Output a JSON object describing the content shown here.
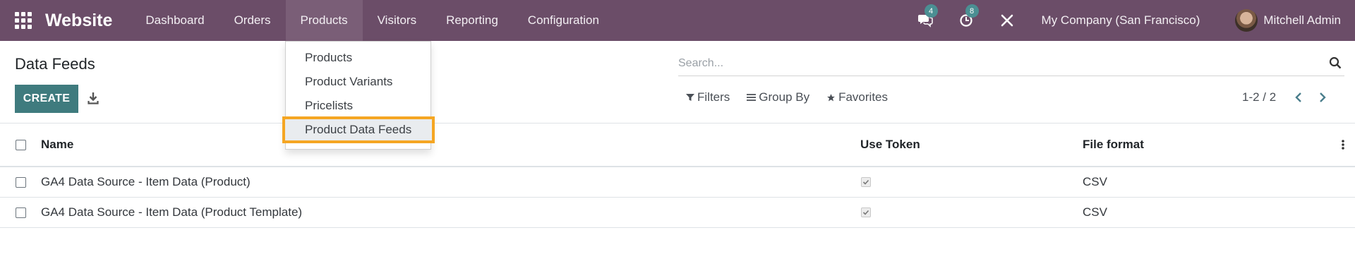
{
  "navbar": {
    "brand": "Website",
    "menu": [
      {
        "label": "Dashboard"
      },
      {
        "label": "Orders"
      },
      {
        "label": "Products"
      },
      {
        "label": "Visitors"
      },
      {
        "label": "Reporting"
      },
      {
        "label": "Configuration"
      }
    ],
    "messages_count": "4",
    "activities_count": "8",
    "company": "My Company (San Francisco)",
    "user": "Mitchell Admin"
  },
  "dropdown": {
    "items": [
      {
        "label": "Products"
      },
      {
        "label": "Product Variants"
      },
      {
        "label": "Pricelists"
      },
      {
        "label": "Product Data Feeds"
      }
    ]
  },
  "control_panel": {
    "title": "Data Feeds",
    "create_label": "CREATE",
    "search_placeholder": "Search...",
    "filters_label": "Filters",
    "groupby_label": "Group By",
    "favorites_label": "Favorites",
    "pager": "1-2 / 2"
  },
  "table": {
    "headers": {
      "name": "Name",
      "use_token": "Use Token",
      "file_format": "File format"
    },
    "rows": [
      {
        "name": "GA4 Data Source - Item Data (Product)",
        "use_token": true,
        "file_format": "CSV"
      },
      {
        "name": "GA4 Data Source - Item Data (Product Template)",
        "use_token": true,
        "file_format": "CSV"
      }
    ]
  },
  "colors": {
    "navbar": "#6b4d68",
    "primary": "#3f7b7e",
    "badge": "#4b8f93",
    "highlight": "#f5a623"
  }
}
